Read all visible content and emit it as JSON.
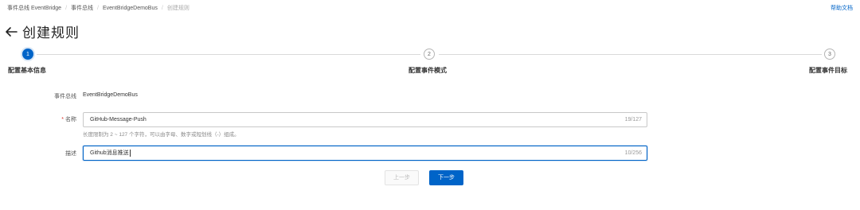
{
  "breadcrumb": {
    "items": [
      "事件总线 EventBridge",
      "事件总线",
      "EventBridgeDemoBus",
      "创建规则"
    ]
  },
  "help_link": "帮助文档",
  "page": {
    "title": "创建规则"
  },
  "steps": [
    {
      "number": "1",
      "label": "配置基本信息",
      "state": "active"
    },
    {
      "number": "2",
      "label": "配置事件模式",
      "state": "pending"
    },
    {
      "number": "3",
      "label": "配置事件目标",
      "state": "pending"
    }
  ],
  "form": {
    "bus": {
      "label": "事件总线",
      "value": "EventBridgeDemoBus"
    },
    "name": {
      "required_mark": "*",
      "label": "名称",
      "value": "GitHub-Message-Push",
      "count": "19/127",
      "hint": "长度限制为 2 ~ 127 个字符，可以由字母、数字或短划线（-）组成。"
    },
    "description": {
      "label": "描述",
      "value": "Github消息推送",
      "count": "10/256"
    }
  },
  "buttons": {
    "prev": "上一步",
    "next": "下一步"
  },
  "colors": {
    "primary": "#0064c8",
    "required": "#d93026"
  }
}
